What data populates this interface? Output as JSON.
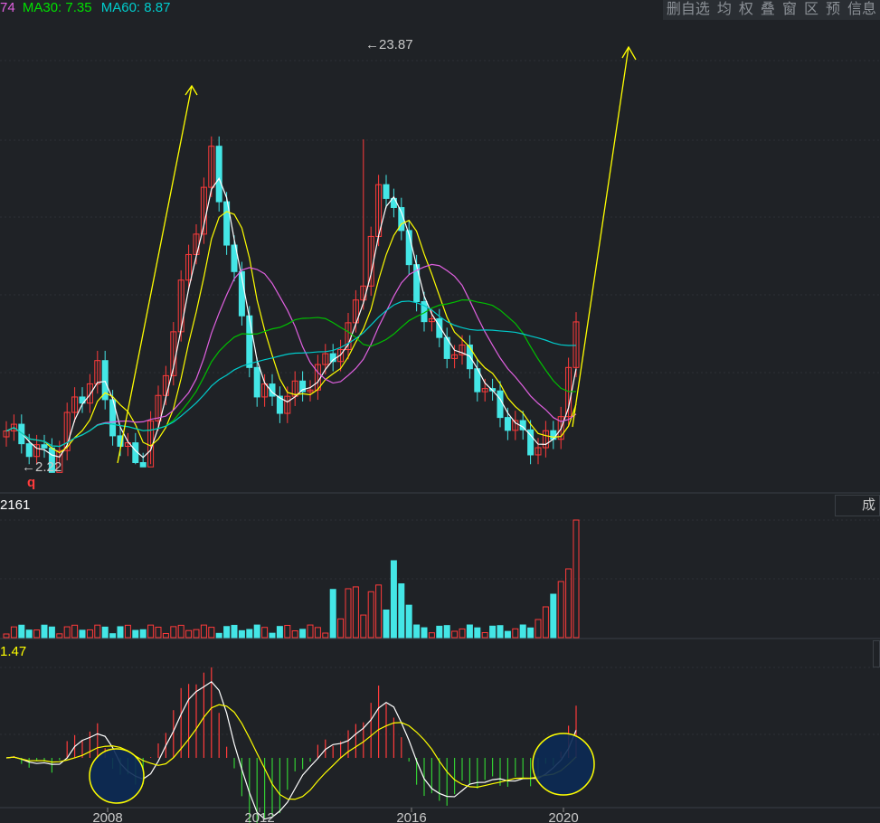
{
  "legend": {
    "ma20_partial": "74",
    "ma30": "MA30: 7.35",
    "ma60": "MA60: 8.87",
    "colors": {
      "ma20": "#e060e0",
      "ma30": "#00e000",
      "ma60": "#00cccc"
    }
  },
  "toolbar": [
    "删自选",
    "均",
    "权",
    "叠",
    "窗",
    "区",
    "预",
    "信息"
  ],
  "price_annotations": {
    "high": "23.87",
    "low": "2.22",
    "marker": "q"
  },
  "volume_panel": {
    "value_label": "2161",
    "tab_label": "成"
  },
  "macd_panel": {
    "value_label": "1.47"
  },
  "x_axis_labels": [
    "2008",
    "2012",
    "2016",
    "2020"
  ],
  "colors": {
    "background": "#1f2226",
    "up": "#ff3b3b",
    "down": "#44e6e6",
    "ma5": "#ffffff",
    "ma10": "#ffff00",
    "ma20": "#e060e0",
    "ma30": "#00c000",
    "ma60": "#00cccc",
    "arrow": "#ffff00",
    "circle_fill": "#0b2a55",
    "circle_border": "#ffff00"
  },
  "chart_data": {
    "type": "candlestick",
    "price_low": 2.22,
    "price_high": 23.87,
    "year_labels": [
      "2008",
      "2012",
      "2016",
      "2020"
    ]
  }
}
